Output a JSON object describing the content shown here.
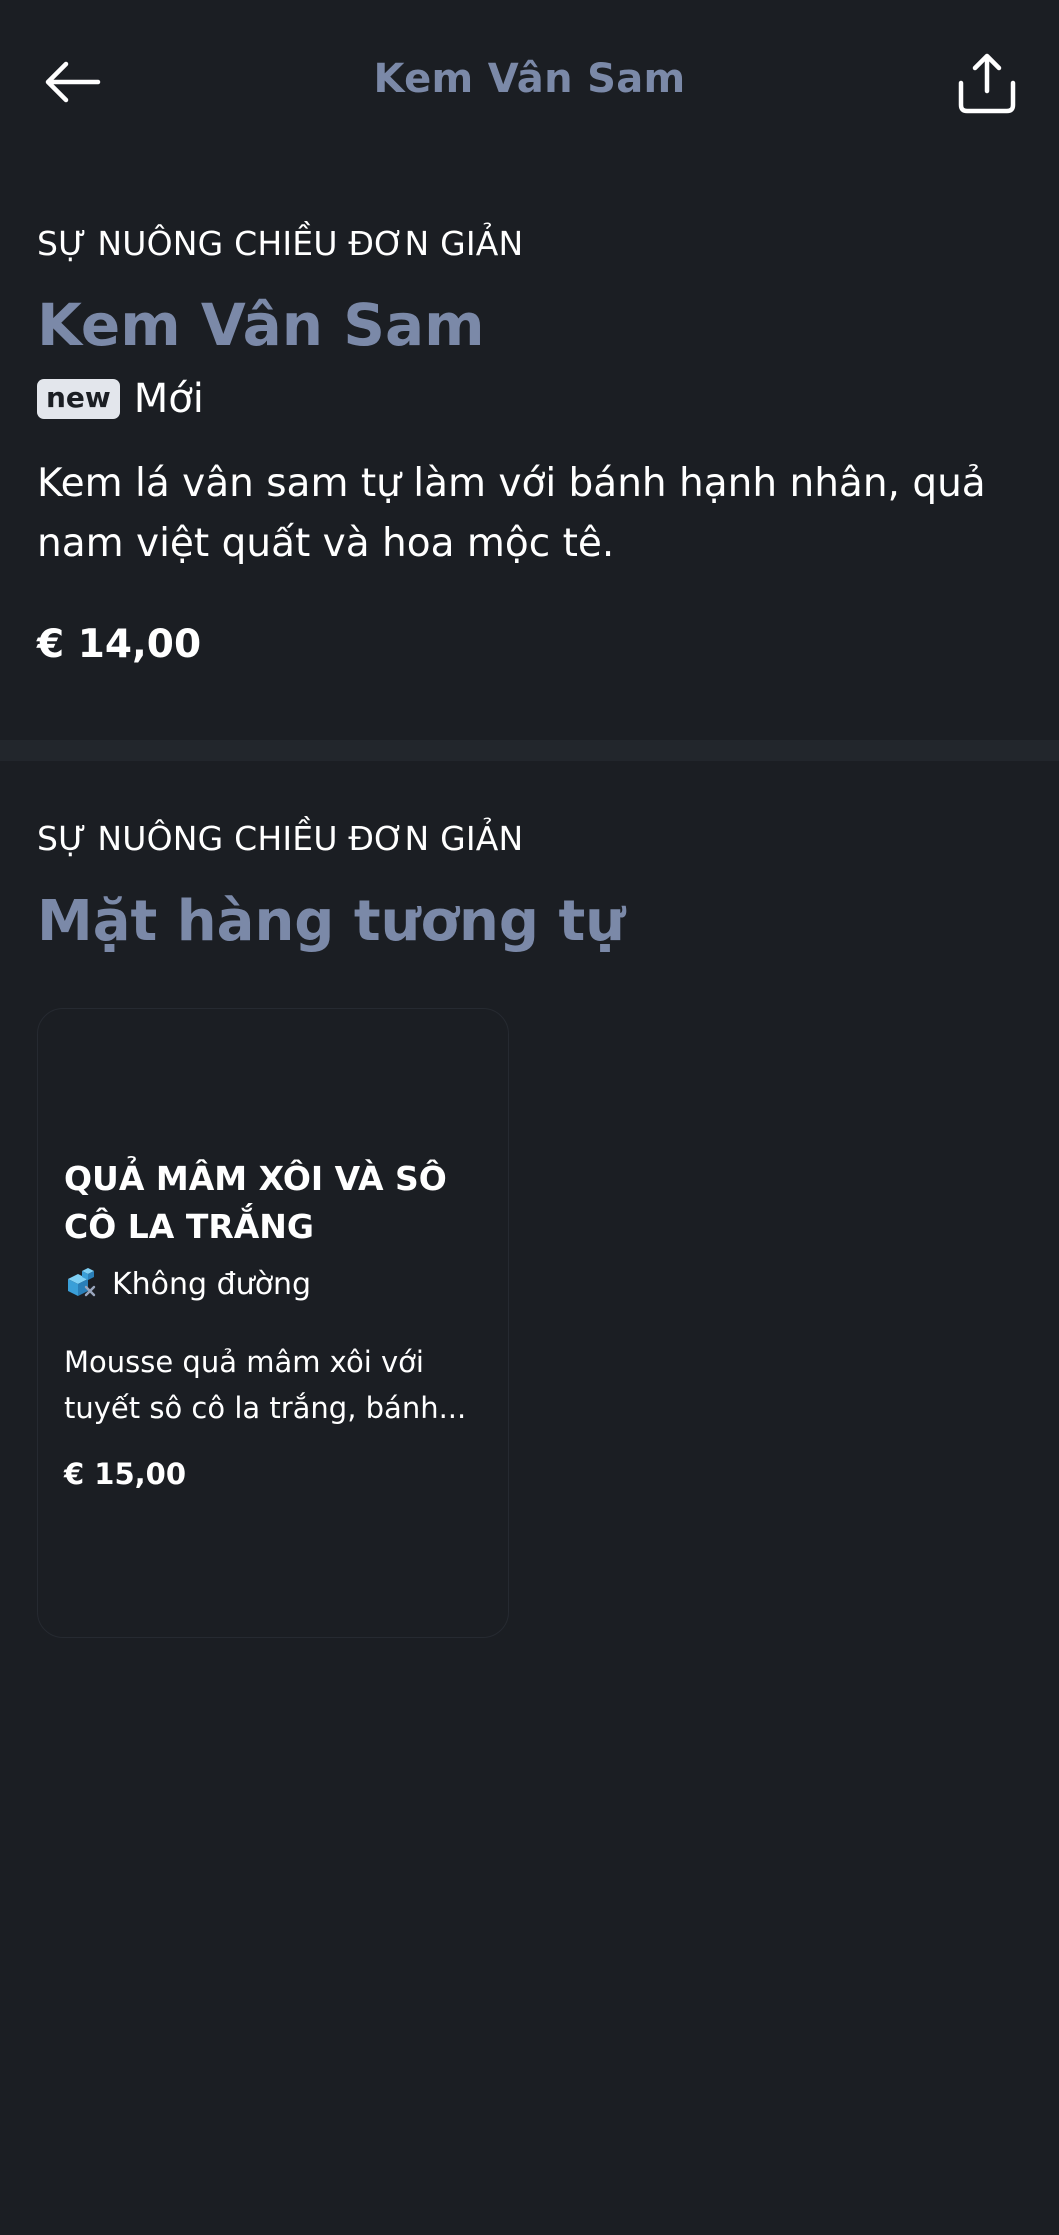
{
  "header": {
    "title": "Kem Vân Sam",
    "back_icon": "arrow-left-icon",
    "share_icon": "share-icon"
  },
  "product": {
    "category": "SỰ NUÔNG CHIỀU ĐƠN GIẢN",
    "name": "Kem Vân Sam",
    "badge": "new",
    "badge_label": "Mới",
    "description": "Kem lá vân sam tự làm với bánh hạnh nhân, quả nam việt quất và hoa mộc tê.",
    "price": "€ 14,00"
  },
  "similar": {
    "category": "SỰ NUÔNG CHIỀU ĐƠN GIẢN",
    "title": "Mặt hàng tương tự",
    "items": [
      {
        "name": "QUẢ MÂM XÔI VÀ SÔ CÔ LA TRẮNG",
        "tag_icon": "sugar-free-icon",
        "tag": "Không đường",
        "description": "Mousse quả mâm xôi với tuyết sô cô la trắng, bánh...",
        "price": "€ 15,00"
      }
    ]
  },
  "colors": {
    "background": "#1b1e23",
    "accent_title": "#7b89a8",
    "divider": "#22262c",
    "tag_icon": "#4fb3e6"
  }
}
